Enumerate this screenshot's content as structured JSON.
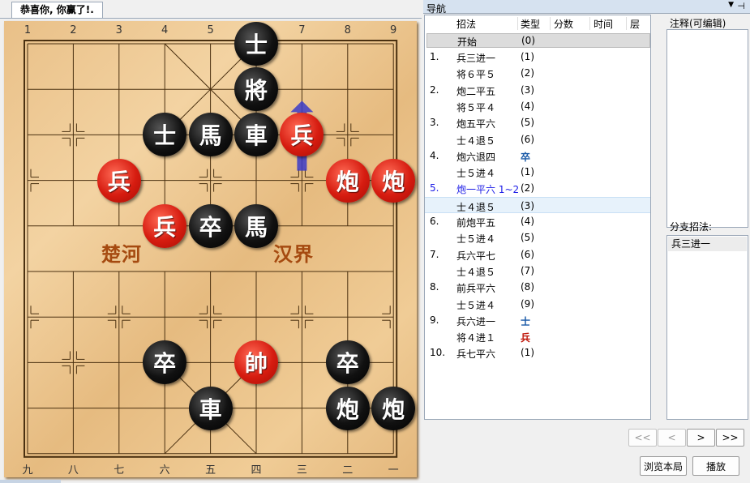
{
  "tab": {
    "title": "恭喜你, 你赢了!."
  },
  "board": {
    "files_top": [
      "1",
      "2",
      "3",
      "4",
      "5",
      "6",
      "7",
      "8",
      "9"
    ],
    "files_bottom": [
      "九",
      "八",
      "七",
      "六",
      "五",
      "四",
      "三",
      "二",
      "一"
    ],
    "river_left": "楚河",
    "river_right": "汉界",
    "pieces": [
      {
        "side": "black",
        "label": "士",
        "col": 5,
        "row": 0
      },
      {
        "side": "black",
        "label": "將",
        "col": 5,
        "row": 1
      },
      {
        "side": "black",
        "label": "士",
        "col": 3,
        "row": 2
      },
      {
        "side": "black",
        "label": "馬",
        "col": 4,
        "row": 2
      },
      {
        "side": "black",
        "label": "車",
        "col": 5,
        "row": 2
      },
      {
        "side": "red",
        "label": "兵",
        "col": 6,
        "row": 2
      },
      {
        "side": "red",
        "label": "兵",
        "col": 2,
        "row": 3
      },
      {
        "side": "red",
        "label": "炮",
        "col": 7,
        "row": 3
      },
      {
        "side": "red",
        "label": "炮",
        "col": 8,
        "row": 3
      },
      {
        "side": "red",
        "label": "兵",
        "col": 3,
        "row": 4
      },
      {
        "side": "black",
        "label": "卒",
        "col": 4,
        "row": 4
      },
      {
        "side": "black",
        "label": "馬",
        "col": 5,
        "row": 4
      },
      {
        "side": "black",
        "label": "卒",
        "col": 3,
        "row": 7
      },
      {
        "side": "red",
        "label": "帥",
        "col": 5,
        "row": 7
      },
      {
        "side": "black",
        "label": "卒",
        "col": 7,
        "row": 7
      },
      {
        "side": "black",
        "label": "車",
        "col": 4,
        "row": 8
      },
      {
        "side": "black",
        "label": "炮",
        "col": 7,
        "row": 8
      },
      {
        "side": "black",
        "label": "炮",
        "col": 8,
        "row": 8
      }
    ],
    "last_move_arrow": {
      "col": 6,
      "from_row": 3,
      "to_row": 2,
      "color": "#3b3bc8"
    }
  },
  "nav": {
    "title": "导航",
    "columns": [
      "招法",
      "类型",
      "分数",
      "时间",
      "层"
    ],
    "start_row": {
      "move": "开始",
      "type": "(0)"
    },
    "rows": [
      {
        "num": "1.",
        "move": "兵三进一",
        "type": "(1)",
        "type_style": "",
        "hl": false
      },
      {
        "num": "",
        "move": "将６平５",
        "type": "(2)",
        "type_style": "",
        "hl": false
      },
      {
        "num": "2.",
        "move": "炮二平五",
        "type": "(3)",
        "type_style": "",
        "hl": false
      },
      {
        "num": "",
        "move": "将５平４",
        "type": "(4)",
        "type_style": "",
        "hl": false
      },
      {
        "num": "3.",
        "move": "炮五平六",
        "type": "(5)",
        "type_style": "",
        "hl": false
      },
      {
        "num": "",
        "move": "士４退５",
        "type": "(6)",
        "type_style": "",
        "hl": false
      },
      {
        "num": "4.",
        "move": "炮六退四",
        "type": "卒",
        "type_style": "black",
        "hl": false
      },
      {
        "num": "",
        "move": "士５进４",
        "type": "(1)",
        "type_style": "",
        "hl": false
      },
      {
        "num": "5.",
        "move": "炮一平六 1~2",
        "type": "(2)",
        "type_style": "",
        "hl": false,
        "blue": true
      },
      {
        "num": "",
        "move": "士４退５",
        "type": "(3)",
        "type_style": "",
        "hl": true
      },
      {
        "num": "6.",
        "move": "前炮平五",
        "type": "(4)",
        "type_style": "",
        "hl": false
      },
      {
        "num": "",
        "move": "士５进４",
        "type": "(5)",
        "type_style": "",
        "hl": false
      },
      {
        "num": "7.",
        "move": "兵六平七",
        "type": "(6)",
        "type_style": "",
        "hl": false
      },
      {
        "num": "",
        "move": "士４退５",
        "type": "(7)",
        "type_style": "",
        "hl": false
      },
      {
        "num": "8.",
        "move": "前兵平六",
        "type": "(8)",
        "type_style": "",
        "hl": false
      },
      {
        "num": "",
        "move": "士５进４",
        "type": "(9)",
        "type_style": "",
        "hl": false
      },
      {
        "num": "9.",
        "move": "兵六进一",
        "type": "士",
        "type_style": "black",
        "hl": false
      },
      {
        "num": "",
        "move": "将４进１",
        "type": "兵",
        "type_style": "red",
        "hl": false
      },
      {
        "num": "10.",
        "move": "兵七平六",
        "type": "(1)",
        "type_style": "",
        "hl": false
      }
    ]
  },
  "notes": {
    "label": "注释(可编辑)"
  },
  "branch": {
    "label": "分支招法:",
    "items": [
      "兵三进一"
    ]
  },
  "buttons": {
    "first": "<<",
    "prev": "<",
    "next": ">",
    "last": ">>",
    "browse": "浏览本局",
    "play": "播放"
  },
  "icons": {
    "pin": "pin-icon",
    "dropdown": "dropdown-icon"
  }
}
